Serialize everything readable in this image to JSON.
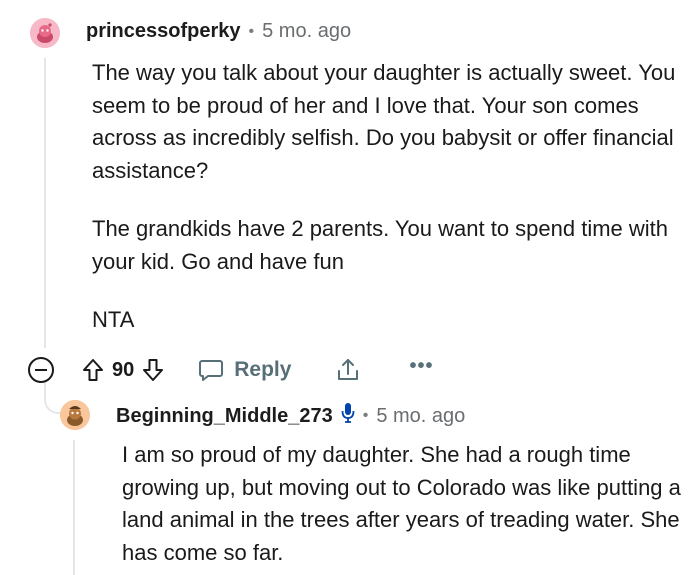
{
  "comment1": {
    "username": "princessofperky",
    "separator": "•",
    "timestamp": "5 mo. ago",
    "avatar_icon": "snoo-avatar-pink",
    "paragraphs": [
      "The way you talk about your daughter is actually sweet. You seem to be proud of her and I love that. Your son comes across as incredibly selfish. Do you babysit or offer financial assistance?",
      "The grandkids have 2 parents. You want to spend time with your kid. Go and have fun",
      "NTA"
    ],
    "actions": {
      "collapse_icon": "collapse-minus-icon",
      "upvote_icon": "upvote-arrow-icon",
      "score": "90",
      "downvote_icon": "downvote-arrow-icon",
      "reply_icon": "speech-bubble-icon",
      "reply_label": "Reply",
      "share_icon": "share-upload-icon",
      "more_icon": "more-ellipsis-icon",
      "more_label": "•••"
    }
  },
  "comment2": {
    "username": "Beginning_Middle_273",
    "badge_icon": "microphone-icon",
    "separator": "•",
    "timestamp": "5 mo. ago",
    "avatar_icon": "snoo-avatar-orange",
    "paragraphs": [
      "I am so proud of my daughter. She had a rough time growing up, but moving out to Colorado was like putting a land animal in the trees after years of treading water. She has come so far."
    ]
  },
  "colors": {
    "thread_line": "#e4e6e8",
    "mic_badge": "#0045ac",
    "avatar1_bg": "#f7b8c8",
    "avatar2_bg": "#f9c79b",
    "muted_text": "#576f76"
  }
}
